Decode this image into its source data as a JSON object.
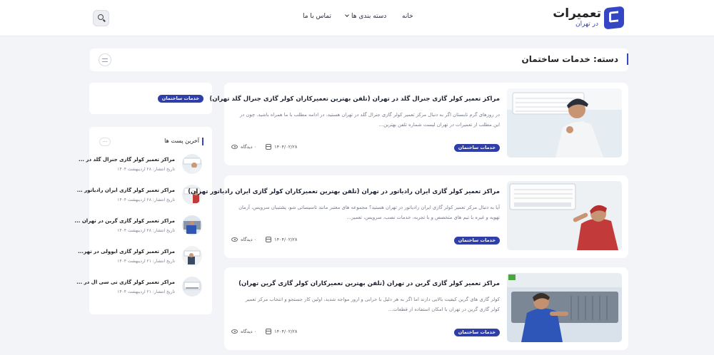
{
  "header": {
    "logo_title": "تعمیرات",
    "logo_subtitle": "در تهران",
    "nav_home": "خانه",
    "nav_categories": "دسته بندی ها",
    "nav_contact": "تماس با ما"
  },
  "category_bar": {
    "title": "دسته: خدمات ساختمان"
  },
  "sidebar": {
    "tag_label": "خدمات ساختمان",
    "recent_title": "آخرین پست ها",
    "recent_more": "...",
    "recent_posts": [
      {
        "title": "مراکز تعمیر کولر گازی جنرال گلد در ...",
        "date": "تاریخ انتشار: ۲۸ اردیبهشت ۱۴۰۴"
      },
      {
        "title": "مراکز تعمیر کولر گازی ایران رادیاتور ...",
        "date": "تاریخ انتشار: ۲۸ اردیبهشت ۱۴۰۴"
      },
      {
        "title": "مراکز تعمیر کولر گازی گرین در تهران ...",
        "date": "تاریخ انتشار: ۲۸ اردیبهشت ۱۴۰۴"
      },
      {
        "title": "مراکز تعمیر کولر گازی ایوولی در تهر...",
        "date": "تاریخ انتشار: ۲۱ اردیبهشت ۱۴۰۴"
      },
      {
        "title": "مراکز تعمیر کولر گازی تی سی ال در ...",
        "date": "تاریخ انتشار: ۲۱ اردیبهشت ۱۴۰۴"
      }
    ]
  },
  "posts": [
    {
      "title": "مراکز تعمیر کولر گازی جنرال گلد در تهران (تلفن بهترین تعمیرکاران کولر گازی جنرال گلد تهران)",
      "excerpt": "در روزهای گرم تابستان اگر به دنبال مرکز تعمیر کولر گازی جنرال گلد در تهران هستید، در ادامه مطلب با ما همراه باشید. چون در این مطلب از تعمیرات در تهران لیست شماره تلفن بهترین...",
      "category": "خدمات ساختمان",
      "date": "۱۴۰۴/۰۲/۲۸",
      "views": "۰ دیدگاه"
    },
    {
      "title": "مراکز تعمیر کولر گازی ایران رادیاتور در تهران (تلفن بهترین تعمیرکاران کولر گازی ایران رادیاتور تهران)",
      "excerpt": "آیا به دنبال مرکز تعمیر کولر گازی ایران رادیاتور در تهران هستید؟ مجموعه های معتبر مانند تاسیساتی شو، پشتیبان سرویس، آرمان تهویه و غیره با تیم های متخصص و با تجربه، خدمات نصب، سرویس، تعمیر...",
      "category": "خدمات ساختمان",
      "date": "۱۴۰۴/۰۲/۲۸",
      "views": "۰ دیدگاه"
    },
    {
      "title": "مراکز تعمیر کولر گازی گرین در تهران (تلفن بهترین تعمیرکاران کولر گازی گرین تهران)",
      "excerpt": "کولر گازی های گرین کیفیت بالایی دارند اما اگر به هر دلیل با خرابی و ارور مواجه شدید، اولین کار جستجو و انتخاب مرکز تعمیر کولر گازی گرین در تهران با امکان استفاده از قطعات...",
      "category": "خدمات ساختمان",
      "date": "۱۴۰۴/۰۲/۲۸",
      "views": "۰ دیدگاه"
    }
  ]
}
